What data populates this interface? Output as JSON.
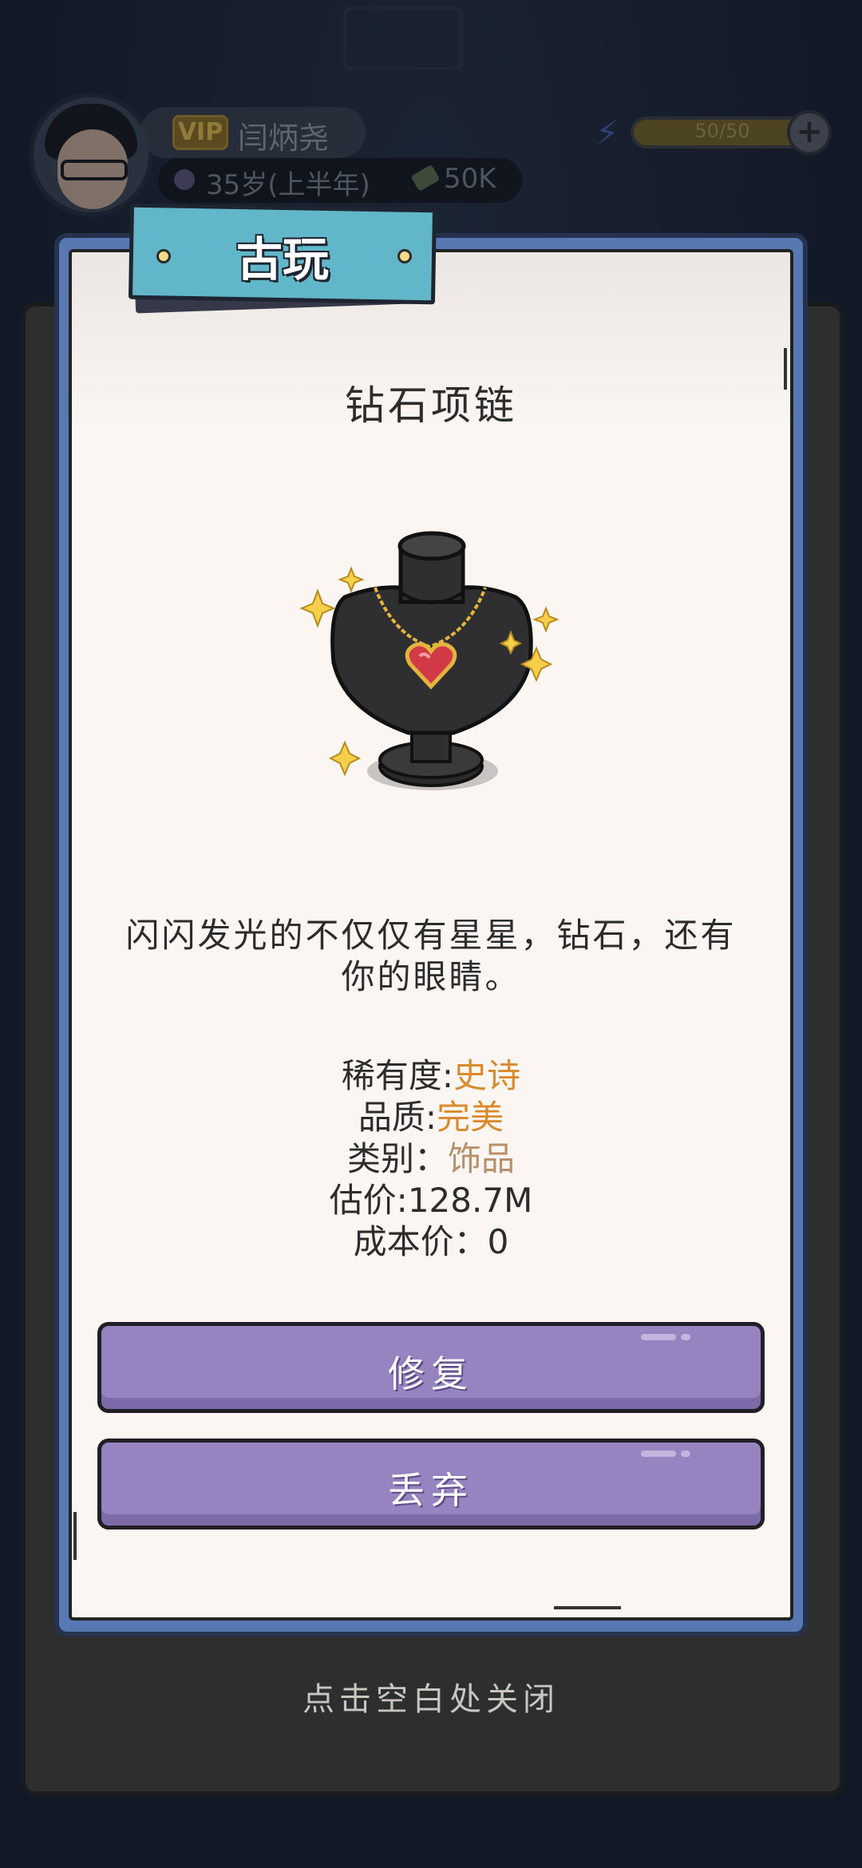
{
  "hud": {
    "vip_label": "VIP",
    "player_name": "闫炳尧",
    "age": "35岁(上半年)",
    "cash": "50K",
    "energy": "50/50",
    "add_label": "+"
  },
  "panel": {
    "tag_title": "古玩",
    "item_name": "钻石项链",
    "description": "闪闪发光的不仅仅有星星，钻石，还有你的眼睛。",
    "stats": {
      "rarity_label": "稀有度:",
      "rarity_value": "史诗",
      "quality_label": "品质:",
      "quality_value": "完美",
      "category_label": "类别：",
      "category_value": "饰品",
      "estimate_label": "估价:",
      "estimate_value": "128.7M",
      "cost_label": "成本价：",
      "cost_value": "0"
    },
    "repair_button": "修复",
    "discard_button": "丢弃"
  },
  "close_hint": "点击空白处关闭",
  "colors": {
    "frame_blue": "#5778b3",
    "tag_teal": "#62b6c9",
    "button_purple": "#9683c0",
    "accent_orange": "#d98a2d",
    "accent_tan": "#b8906a"
  }
}
